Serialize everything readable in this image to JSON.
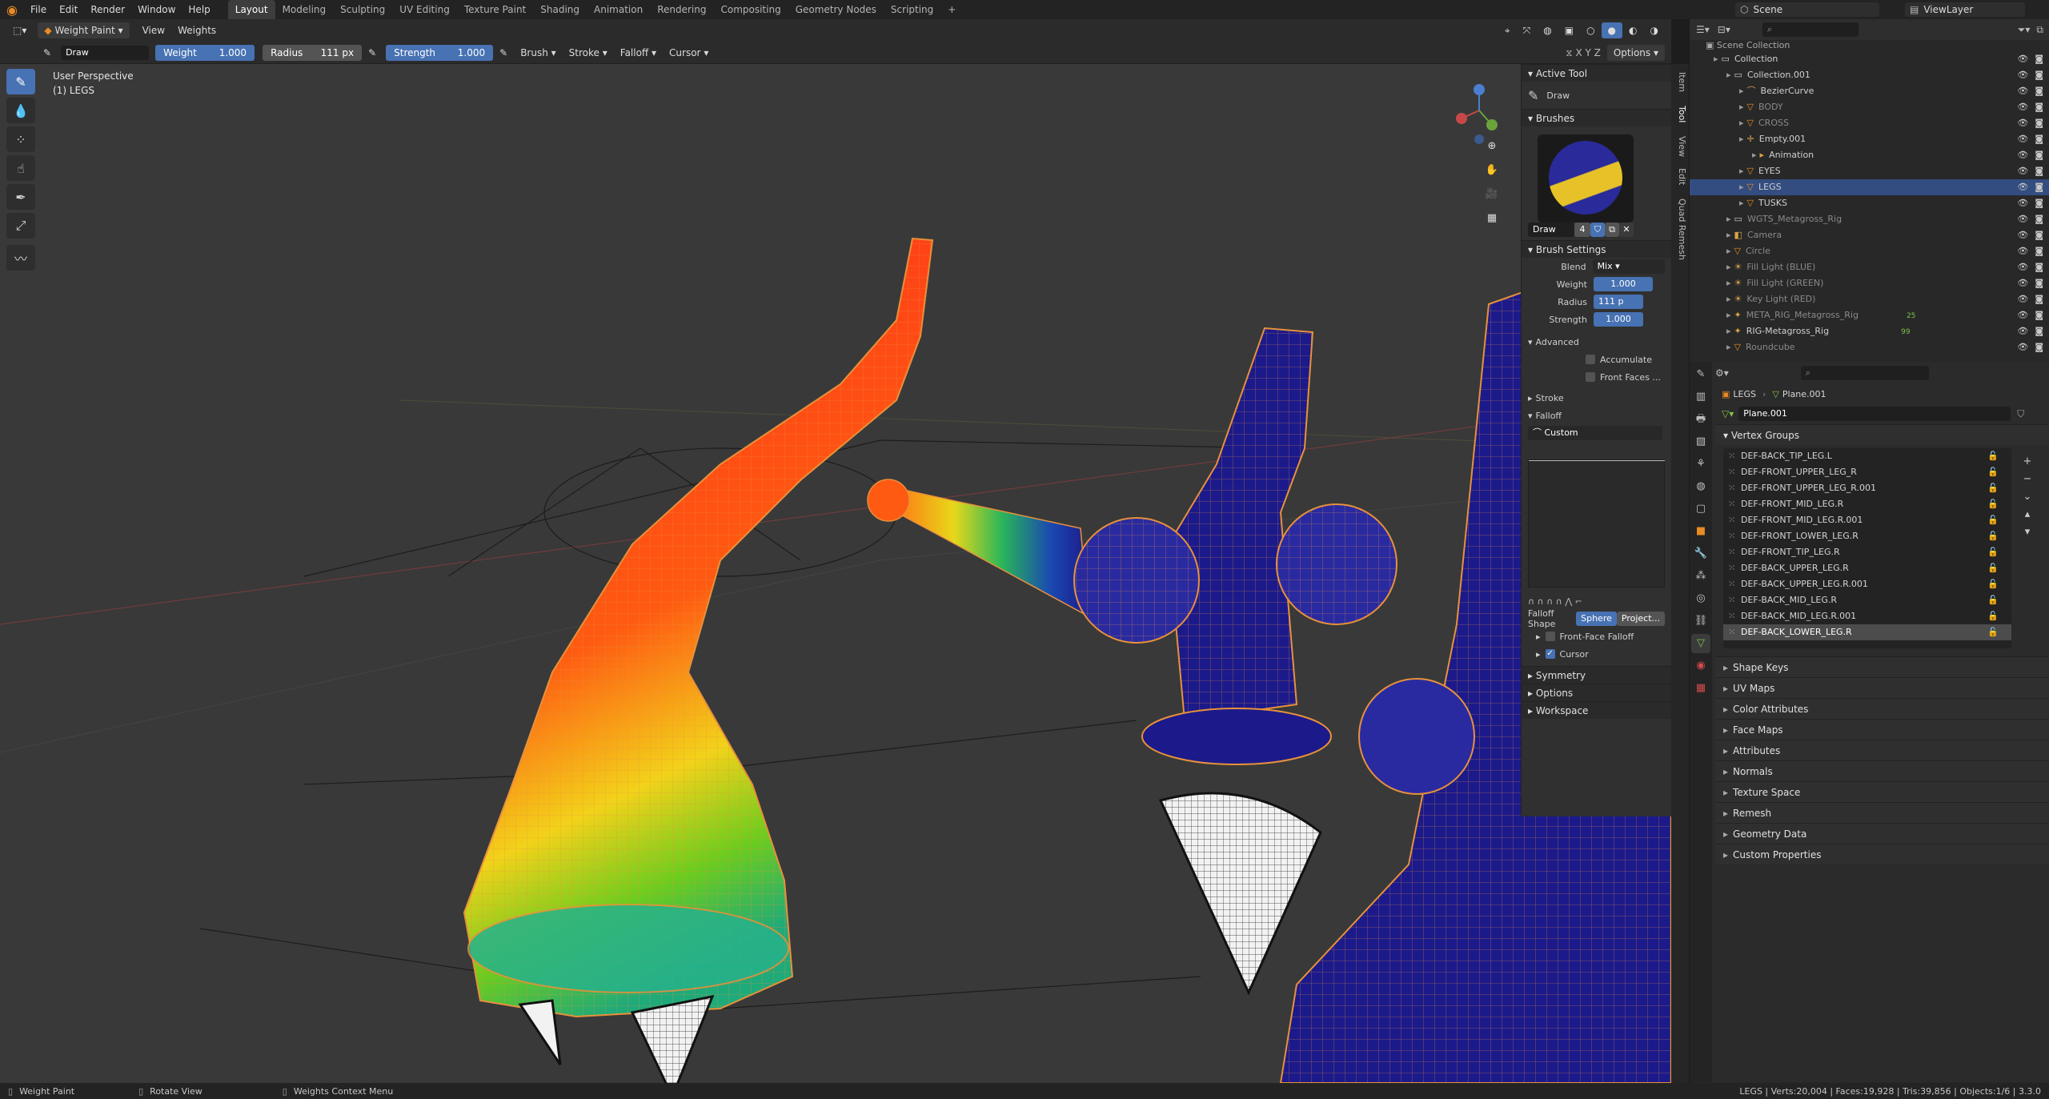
{
  "topbar": {
    "menus": [
      "File",
      "Edit",
      "Render",
      "Window",
      "Help"
    ],
    "workspaces": [
      "Layout",
      "Modeling",
      "Sculpting",
      "UV Editing",
      "Texture Paint",
      "Shading",
      "Animation",
      "Rendering",
      "Compositing",
      "Geometry Nodes",
      "Scripting",
      "+"
    ],
    "active_workspace": "Layout",
    "scene": "Scene",
    "view_layer": "ViewLayer"
  },
  "area_header": {
    "mode": "Weight Paint",
    "view": "View",
    "weights": "Weights"
  },
  "tool_header": {
    "brush_name": "Draw",
    "weight_label": "Weight",
    "weight_value": "1.000",
    "radius_label": "Radius",
    "radius_value": "111 px",
    "strength_label": "Strength",
    "strength_value": "1.000",
    "brush": "Brush",
    "stroke": "Stroke",
    "falloff": "Falloff",
    "cursor": "Cursor",
    "options": "Options"
  },
  "viewport": {
    "perspective": "User Perspective",
    "object": "(1) LEGS"
  },
  "npanel": {
    "tabs": [
      "Item",
      "Tool",
      "View",
      "Edit",
      "Quad Remesh"
    ],
    "active_tool_title": "Active Tool",
    "active_tool": "Draw",
    "brushes_title": "Brushes",
    "brush_name": "Draw",
    "brush_users": "4",
    "brush_settings_title": "Brush Settings",
    "blend_label": "Blend",
    "blend_value": "Mix",
    "weight_label": "Weight",
    "weight_value": "1.000",
    "radius_label": "Radius",
    "radius_value": "111 p",
    "strength_label": "Strength",
    "strength_value": "1.000",
    "advanced": "Advanced",
    "accumulate": "Accumulate",
    "front_faces": "Front Faces ...",
    "stroke": "Stroke",
    "falloff": "Falloff",
    "falloff_preset": "Custom",
    "falloff_shape_label": "Falloff Shape",
    "falloff_sphere": "Sphere",
    "falloff_project": "Project...",
    "front_face_falloff": "Front-Face Falloff",
    "cursor": "Cursor",
    "symmetry": "Symmetry",
    "options": "Options",
    "workspace": "Workspace"
  },
  "outliner": {
    "title": "Scene Collection",
    "rows": [
      {
        "label": "Collection",
        "indent": 1,
        "icon": "collection-icon",
        "dim": false,
        "sel": false
      },
      {
        "label": "Collection.001",
        "indent": 2,
        "icon": "collection-icon",
        "dim": false,
        "sel": false
      },
      {
        "label": "BezierCurve",
        "indent": 3,
        "icon": "curve-icon",
        "dim": false,
        "sel": false
      },
      {
        "label": "BODY",
        "indent": 3,
        "icon": "mesh-icon",
        "dim": true,
        "sel": false
      },
      {
        "label": "CROSS",
        "indent": 3,
        "icon": "mesh-icon",
        "dim": true,
        "sel": false
      },
      {
        "label": "Empty.001",
        "indent": 3,
        "icon": "empty-icon",
        "dim": false,
        "sel": false
      },
      {
        "label": "Animation",
        "indent": 4,
        "icon": "action-icon",
        "dim": false,
        "sel": false
      },
      {
        "label": "EYES",
        "indent": 3,
        "icon": "mesh-icon",
        "dim": false,
        "sel": false
      },
      {
        "label": "LEGS",
        "indent": 3,
        "icon": "mesh-icon",
        "dim": false,
        "sel": true
      },
      {
        "label": "TUSKS",
        "indent": 3,
        "icon": "mesh-icon",
        "dim": false,
        "sel": false
      },
      {
        "label": "WGTS_Metagross_Rig",
        "indent": 2,
        "icon": "collection-icon",
        "dim": true,
        "sel": false
      },
      {
        "label": "Camera",
        "indent": 2,
        "icon": "camera-icon",
        "dim": true,
        "sel": false
      },
      {
        "label": "Circle",
        "indent": 2,
        "icon": "mesh-icon",
        "dim": true,
        "sel": false
      },
      {
        "label": "Fill Light (BLUE)",
        "indent": 2,
        "icon": "light-icon",
        "dim": true,
        "sel": false
      },
      {
        "label": "Fill Light (GREEN)",
        "indent": 2,
        "icon": "light-icon",
        "dim": true,
        "sel": false
      },
      {
        "label": "Key Light (RED)",
        "indent": 2,
        "icon": "light-icon",
        "dim": true,
        "sel": false
      },
      {
        "label": "META_RIG_Metagross_Rig",
        "indent": 2,
        "icon": "armature-icon",
        "dim": true,
        "sel": false
      },
      {
        "label": "RIG-Metagross_Rig",
        "indent": 2,
        "icon": "armature-icon",
        "dim": false,
        "sel": false
      },
      {
        "label": "Roundcube",
        "indent": 2,
        "icon": "mesh-icon",
        "dim": true,
        "sel": false
      }
    ],
    "badges": {
      "meta": "25",
      "rig": "99"
    }
  },
  "properties": {
    "breadcrumb_object": "LEGS",
    "breadcrumb_mesh": "Plane.001",
    "mesh_name": "Plane.001",
    "vertex_groups_title": "Vertex Groups",
    "vertex_groups": [
      "DEF-BACK_TIP_LEG.L",
      "DEF-FRONT_UPPER_LEG_R",
      "DEF-FRONT_UPPER_LEG_R.001",
      "DEF-FRONT_MID_LEG.R",
      "DEF-FRONT_MID_LEG.R.001",
      "DEF-FRONT_LOWER_LEG.R",
      "DEF-FRONT_TIP_LEG.R",
      "DEF-BACK_UPPER_LEG.R",
      "DEF-BACK_UPPER_LEG.R.001",
      "DEF-BACK_MID_LEG.R",
      "DEF-BACK_MID_LEG.R.001",
      "DEF-BACK_LOWER_LEG.R"
    ],
    "selected_group": "DEF-BACK_LOWER_LEG.R",
    "panels": [
      "Shape Keys",
      "UV Maps",
      "Color Attributes",
      "Face Maps",
      "Attributes",
      "Normals",
      "Texture Space",
      "Remesh",
      "Geometry Data",
      "Custom Properties"
    ]
  },
  "statusbar": {
    "left1": "Weight Paint",
    "left2": "Rotate View",
    "left3": "Weights Context Menu",
    "stats": "LEGS | Verts:20,004 | Faces:19,928 | Tris:39,856 | Objects:1/6 | 3.3.0"
  },
  "colors": {
    "accent": "#4772b3",
    "selected_row": "#334d80",
    "outline_orange": "#e8913a",
    "mesh_blue": "#1c1a8a"
  }
}
